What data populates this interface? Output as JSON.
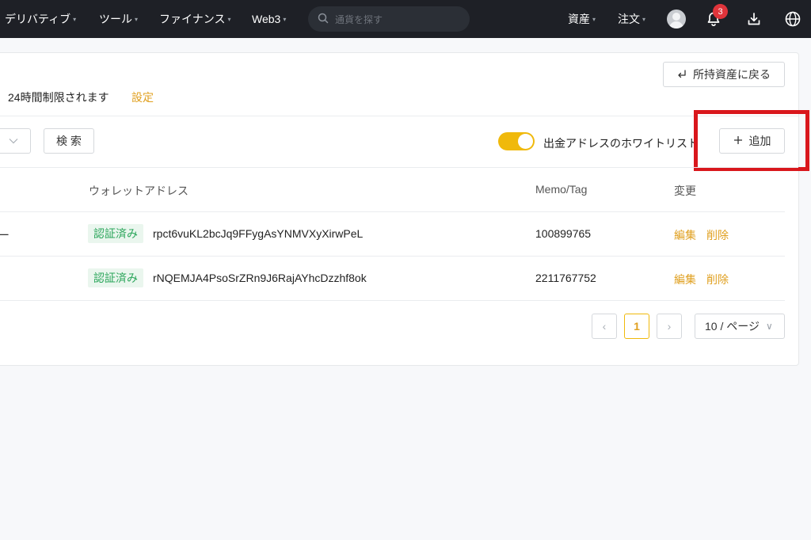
{
  "nav": {
    "items": [
      {
        "label": "デリバティブ",
        "caret": "▾"
      },
      {
        "label": "ツール",
        "caret": "▾"
      },
      {
        "label": "ファイナンス",
        "caret": "▾"
      },
      {
        "label": "Web3",
        "caret": "▾"
      }
    ],
    "search_placeholder": "通貨を探す",
    "assets": "資産",
    "orders": "注文",
    "notification_count": "3",
    "caret": "▾"
  },
  "header": {
    "back_button": "所持資産に戻る",
    "notice": "24時間制限されます",
    "setting_link": "設定"
  },
  "toolbar": {
    "search_button": "検 索",
    "whitelist_label": "出金アドレスのホワイトリスト",
    "whitelist_enabled": true,
    "add_button": "追加"
  },
  "table": {
    "columns": [
      "ウォレットアドレス",
      "Memo/Tag",
      "変更"
    ],
    "rows": [
      {
        "prefix": "ー",
        "status": "認証済み",
        "address": "rpct6vuKL2bcJq9FFygAsYNMVXyXirwPeL",
        "memo": "100899765",
        "edit": "編集",
        "delete": "削除"
      },
      {
        "prefix": "",
        "status": "認証済み",
        "address": "rNQEMJA4PsoSrZRn9J6RajAYhcDzzhf8ok",
        "memo": "2211767752",
        "edit": "編集",
        "delete": "削除"
      }
    ]
  },
  "pagination": {
    "prev": "‹",
    "current_page": "1",
    "next": "›",
    "page_size": "10 / ページ",
    "chevron": "∨"
  },
  "colors": {
    "accent": "#f0b90b",
    "highlight_box": "#d9171c",
    "verified_text": "#2aa55a"
  }
}
